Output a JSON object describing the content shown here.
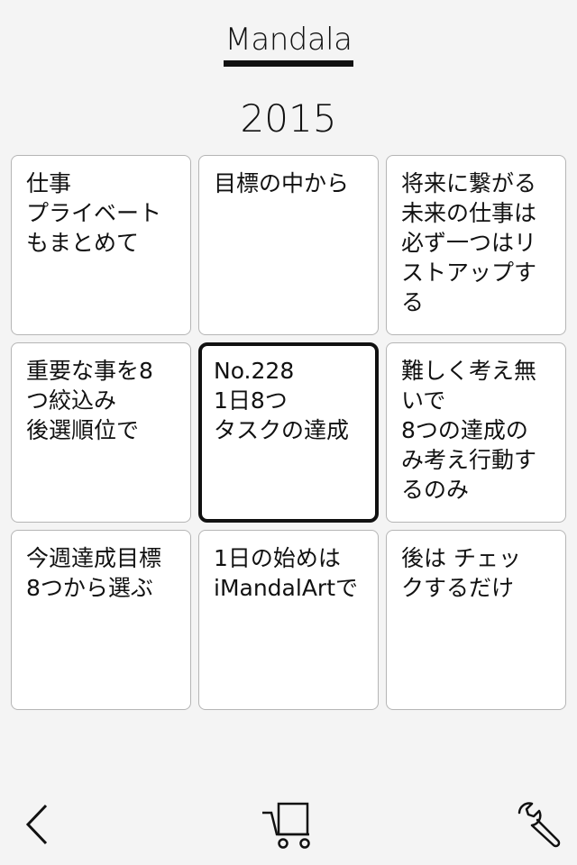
{
  "header": {
    "title": "Mandala",
    "year": "2015"
  },
  "grid": {
    "cells": [
      "仕事\nプライベート\nもまとめて",
      "目標の中から",
      "将来に繋がる\n未来の仕事は\n必ず一つはリ\nストアップす\nる",
      "重要な事を8\nつ絞込み\n後選順位で",
      "No.228\n1日8つ\nタスクの達成",
      "難しく考え無\nいで\n8つの達成の\nみ考え行動す\nるのみ",
      "今週達成目標\n8つから選ぶ",
      "1日の始めは\niMandalArtで",
      "後は チェッ\nクするだけ"
    ]
  },
  "toolbar": {
    "icons": [
      "back-chevron-icon",
      "cart-icon",
      "wrench-icon"
    ]
  },
  "colors": {
    "background": "#f4f4f4",
    "cell_background": "#ffffff",
    "cell_border": "#b5b5b5",
    "ink": "#111111"
  }
}
